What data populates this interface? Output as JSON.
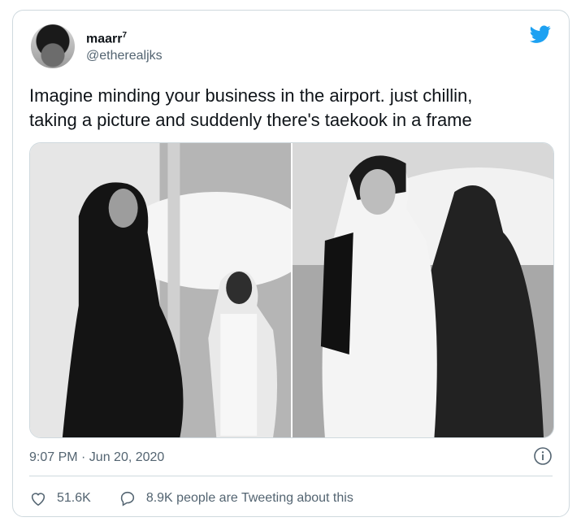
{
  "tweet": {
    "display_name": "maarr",
    "display_name_sup": "7",
    "handle": "@etherealjks",
    "text_line1": "Imagine minding your business in the airport. just chillin,",
    "text_line2": "taking a picture and suddenly there's taekook in a frame",
    "timestamp": "9:07 PM · Jun 20, 2020",
    "likes": "51.6K",
    "retweet_text": "8.9K people are Tweeting about this"
  },
  "icons": {
    "brand": "twitter-bird-icon",
    "info": "info-icon",
    "like": "heart-icon",
    "reply": "speech-bubble-icon"
  },
  "colors": {
    "brand": "#1da1f2",
    "text": "#0f1419",
    "muted": "#536471",
    "border": "#cfd9de"
  }
}
